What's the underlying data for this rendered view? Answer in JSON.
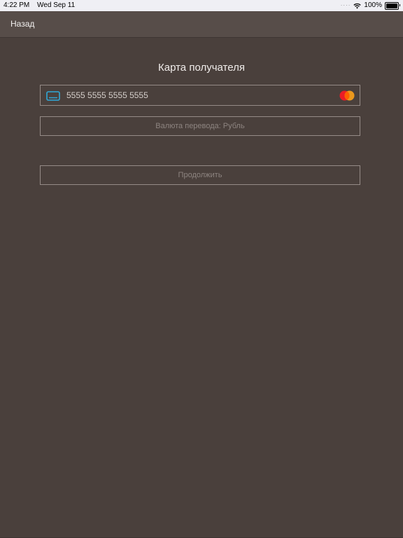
{
  "status_bar": {
    "time": "4:22 PM",
    "date": "Wed Sep 11",
    "battery": "100%",
    "battery_level": 1.0
  },
  "nav": {
    "back_label": "Назад"
  },
  "form": {
    "title": "Карта получателя",
    "card_number": "5555 5555 5555 5555",
    "card_brand": "mastercard",
    "currency_label": "Валюта перевода: Рубль",
    "continue_label": "Продолжить"
  },
  "colors": {
    "background": "#4a403c",
    "nav_background": "#574d49",
    "card_icon_accent": "#2fa8d8",
    "field_border": "#958b87"
  }
}
